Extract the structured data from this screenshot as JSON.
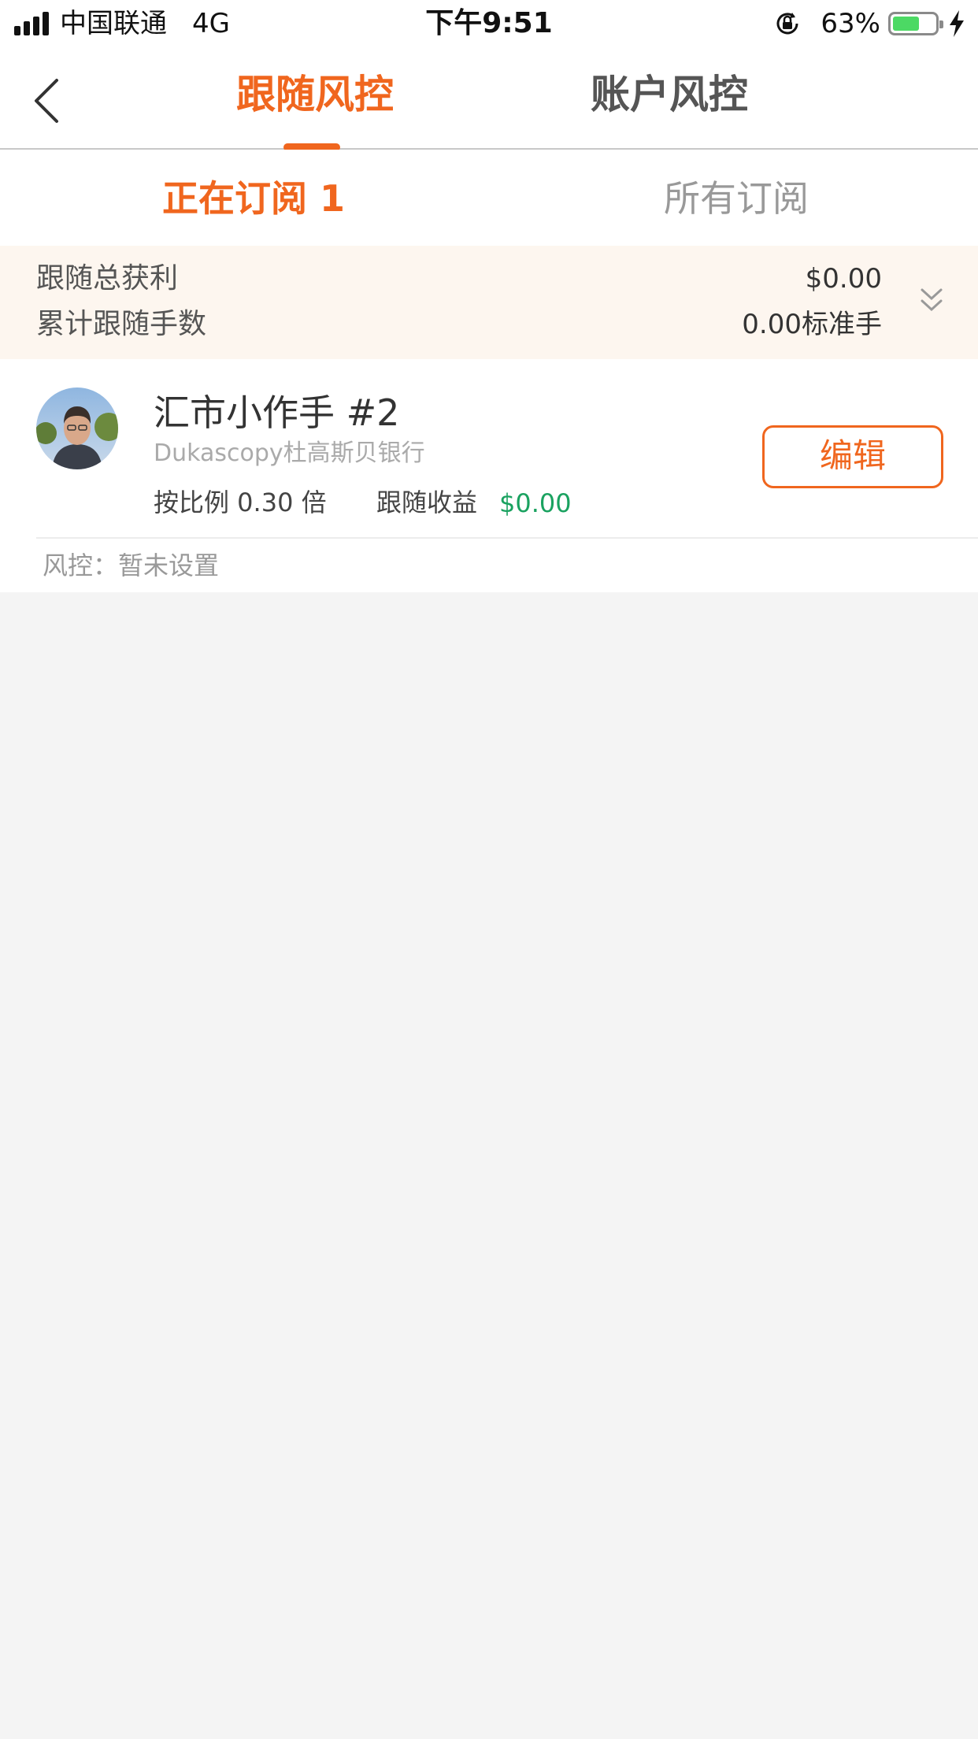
{
  "status_bar": {
    "carrier": "中国联通",
    "network": "4G",
    "time": "下午9:51",
    "battery_percent": "63%",
    "battery_level": 0.63,
    "battery_color": "#4cd964",
    "icons": [
      "signal-icon",
      "rotation-lock-icon",
      "battery-icon",
      "charging-bolt-icon"
    ]
  },
  "header": {
    "tabs": [
      {
        "label": "跟随风控",
        "active": true
      },
      {
        "label": "账户风控",
        "active": false
      }
    ],
    "accent_color": "#f0661e"
  },
  "subtabs": [
    {
      "label": "正在订阅 1",
      "active": true
    },
    {
      "label": "所有订阅",
      "active": false
    }
  ],
  "summary": {
    "total_profit_label": "跟随总获利",
    "total_profit_value": "$0.00",
    "total_lots_label": "累计跟随手数",
    "total_lots_value": "0.00标准手"
  },
  "subscriptions": [
    {
      "name": "汇市小作手 #2",
      "broker": "Dukascopy杜高斯贝银行",
      "ratio": "按比例 0.30 倍",
      "profit_label": "跟随收益",
      "profit_value": "$0.00",
      "edit_label": "编辑",
      "risk_label": "风控：",
      "risk_value": "暂未设置"
    }
  ]
}
